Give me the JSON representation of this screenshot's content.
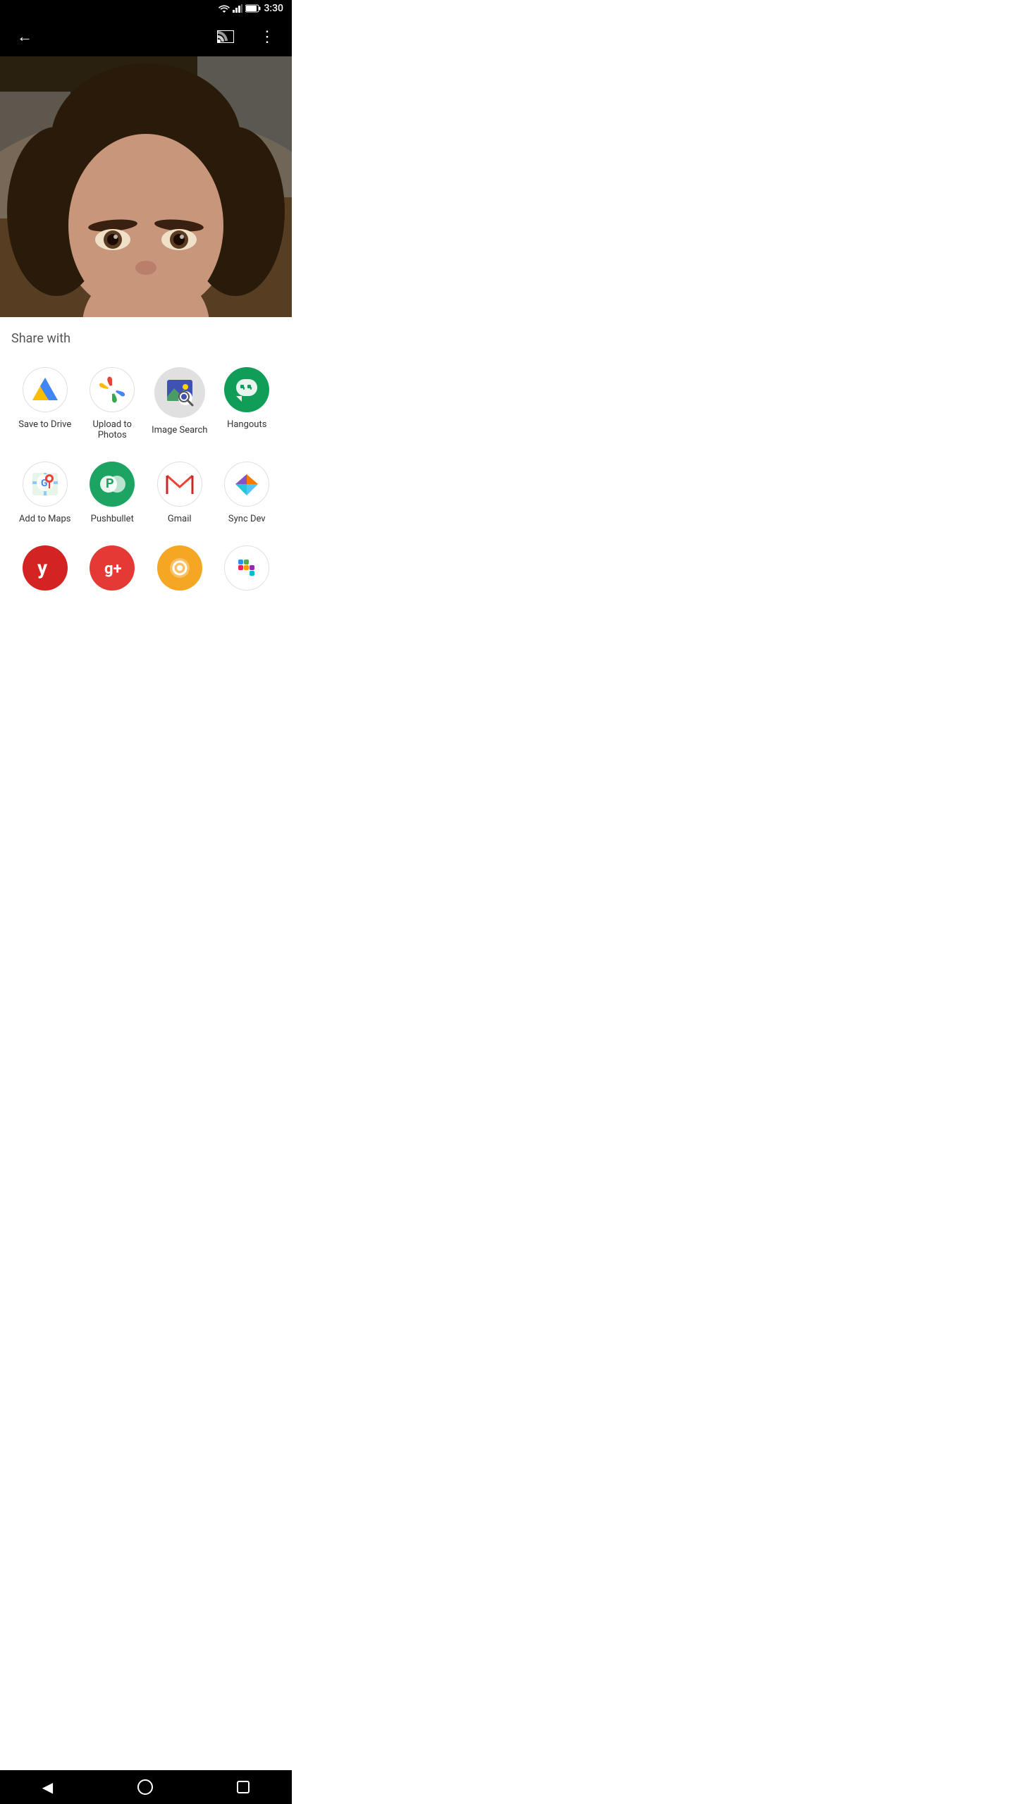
{
  "status_bar": {
    "time": "3:30",
    "battery": "84"
  },
  "top_bar": {
    "back_icon": "←",
    "cast_icon": "cast",
    "more_icon": "⋮"
  },
  "share_section": {
    "title": "Share with"
  },
  "apps": {
    "row1": [
      {
        "id": "save-to-drive",
        "label": "Save to Drive",
        "icon_type": "drive"
      },
      {
        "id": "upload-to-photos",
        "label": "Upload to Photos",
        "icon_type": "photos"
      },
      {
        "id": "image-search",
        "label": "Image Search",
        "icon_type": "imagesearch"
      },
      {
        "id": "hangouts",
        "label": "Hangouts",
        "icon_type": "hangouts"
      }
    ],
    "row2": [
      {
        "id": "add-to-maps",
        "label": "Add to Maps",
        "icon_type": "maps"
      },
      {
        "id": "pushbullet",
        "label": "Pushbullet",
        "icon_type": "pushbullet"
      },
      {
        "id": "gmail",
        "label": "Gmail",
        "icon_type": "gmail"
      },
      {
        "id": "sync-dev",
        "label": "Sync Dev",
        "icon_type": "syncdev"
      }
    ],
    "row3": [
      {
        "id": "yelp",
        "label": "Yelp",
        "icon_type": "yelp"
      },
      {
        "id": "google-plus",
        "label": "Google+",
        "icon_type": "gplus"
      },
      {
        "id": "finder",
        "label": "Finder",
        "icon_type": "finder"
      },
      {
        "id": "slack",
        "label": "Slack",
        "icon_type": "slack"
      }
    ]
  },
  "nav": {
    "back": "◀",
    "home": "○",
    "recents": "□"
  }
}
